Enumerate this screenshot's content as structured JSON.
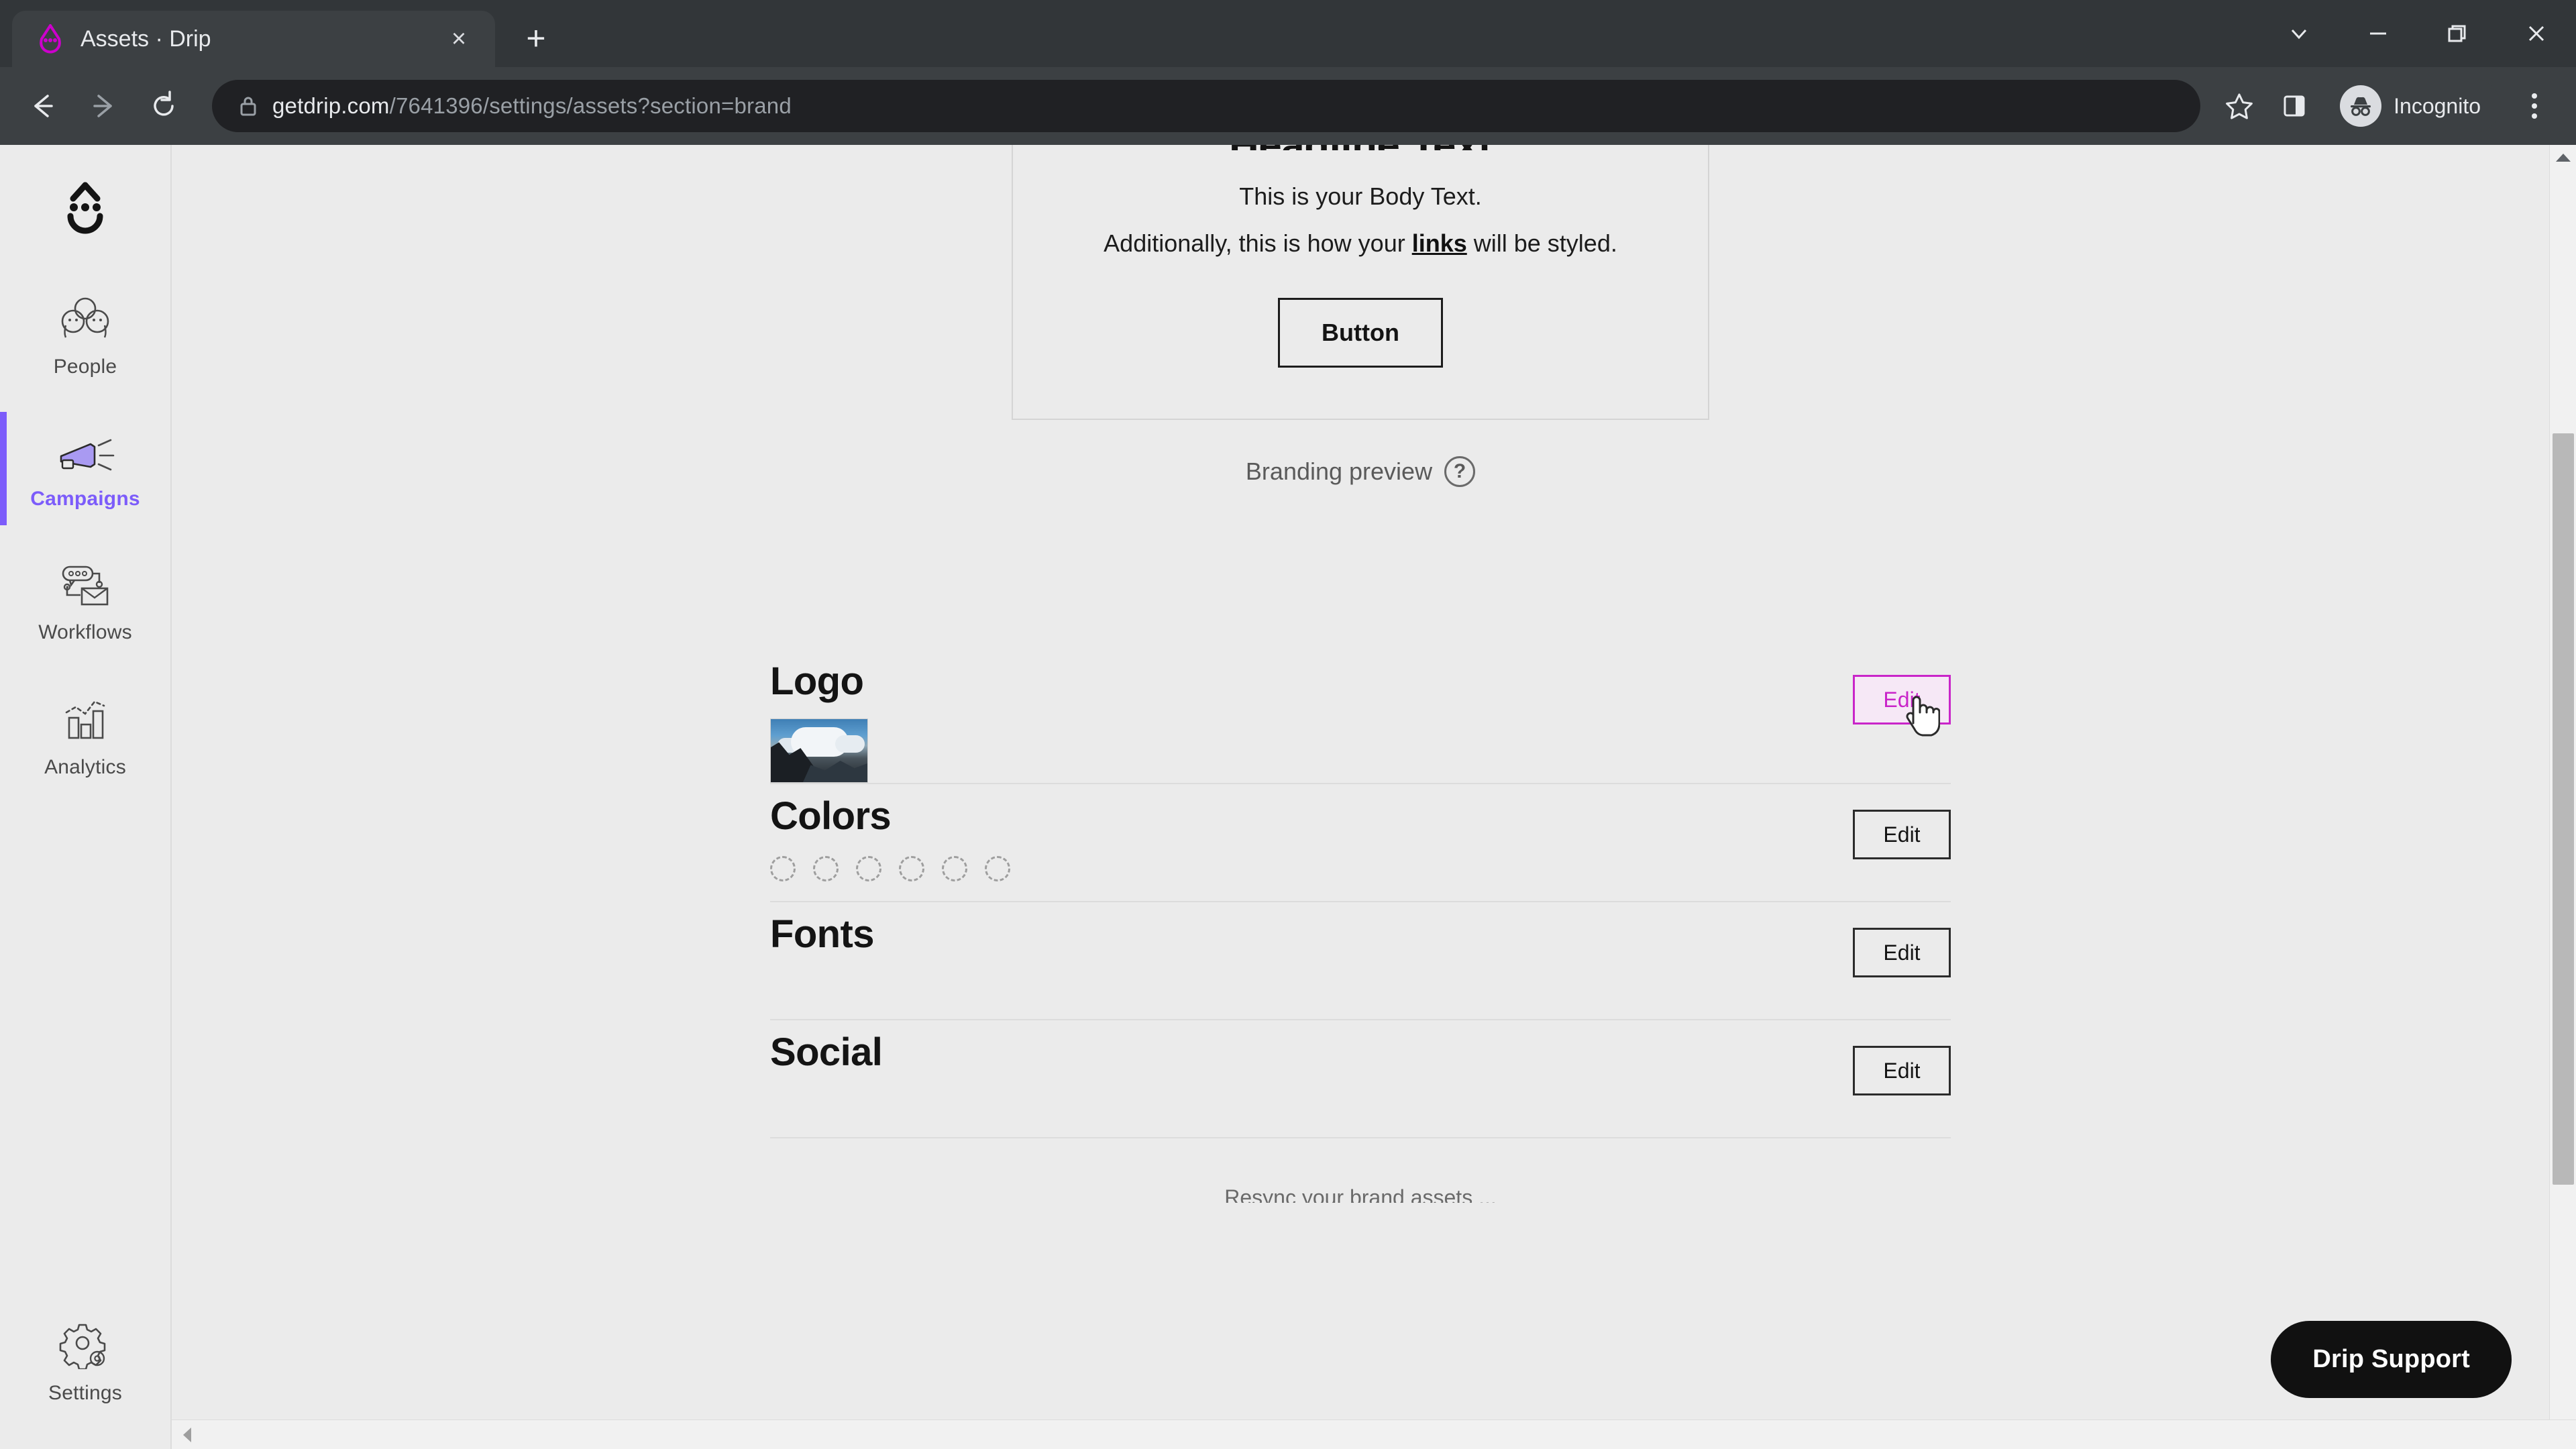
{
  "browser": {
    "tab": {
      "title": "Assets · Drip",
      "favicon_name": "drip-droplet-favicon",
      "close_label": "×"
    },
    "new_tab_label": "+",
    "window_controls": {
      "tab_search": "⌄",
      "minimize": "–",
      "restore": "❐",
      "close": "✕"
    },
    "nav": {
      "back": "←",
      "forward": "→",
      "reload": "⟳"
    },
    "omnibox": {
      "lock_icon": "lock-icon",
      "url_domain": "getdrip.com",
      "url_path": "/7641396/settings/assets?section=brand",
      "full_url": "getdrip.com/7641396/settings/assets?section=brand"
    },
    "star_icon": "bookmark-star-icon",
    "side_panel_icon": "side-panel-icon",
    "profile": {
      "label": "Incognito",
      "icon": "incognito-icon"
    },
    "menu_icon": "three-dot-menu-icon"
  },
  "sidebar": {
    "logo_name": "drip-logo",
    "items": [
      {
        "label": "People",
        "icon": "people-icon",
        "active": false
      },
      {
        "label": "Campaigns",
        "icon": "megaphone-icon",
        "active": true
      },
      {
        "label": "Workflows",
        "icon": "workflow-icon",
        "active": false
      },
      {
        "label": "Analytics",
        "icon": "bar-chart-icon",
        "active": false
      }
    ],
    "bottom_item": {
      "label": "Settings",
      "icon": "gear-icon",
      "active": false
    },
    "active_color": "#7c5cfa"
  },
  "preview": {
    "headline": "Headline Text",
    "body_line_1": "This is your Body Text.",
    "body_line_2_before": "Additionally, this is how your ",
    "body_line_2_link": "links",
    "body_line_2_after": " will be styled.",
    "button_label": "Button",
    "caption": "Branding preview",
    "help_icon_label": "?"
  },
  "assets": {
    "rows": [
      {
        "title": "Logo",
        "edit_label": "Edit",
        "edit_hovered": true,
        "content_type": "image-thumbnail",
        "thumbnail_name": "logo-thumbnail"
      },
      {
        "title": "Colors",
        "edit_label": "Edit",
        "edit_hovered": false,
        "content_type": "color-swatches",
        "swatch_count": 6,
        "swatches_empty": true
      },
      {
        "title": "Fonts",
        "edit_label": "Edit",
        "edit_hovered": false,
        "content_type": "none"
      },
      {
        "title": "Social",
        "edit_label": "Edit",
        "edit_hovered": false,
        "content_type": "none"
      }
    ],
    "resync_text": "Resync your brand assets ..."
  },
  "support": {
    "label": "Drip Support"
  },
  "colors": {
    "accent_purple": "#7c5cfa",
    "hover_magenta": "#c925c9",
    "page_bg": "#ebebeb",
    "chrome_dark": "#3c4043",
    "omnibox_bg": "#202124",
    "support_bg": "#111111"
  },
  "scroll": {
    "vertical_up_arrow": "▲",
    "horizontal_left_arrow": "◀"
  }
}
